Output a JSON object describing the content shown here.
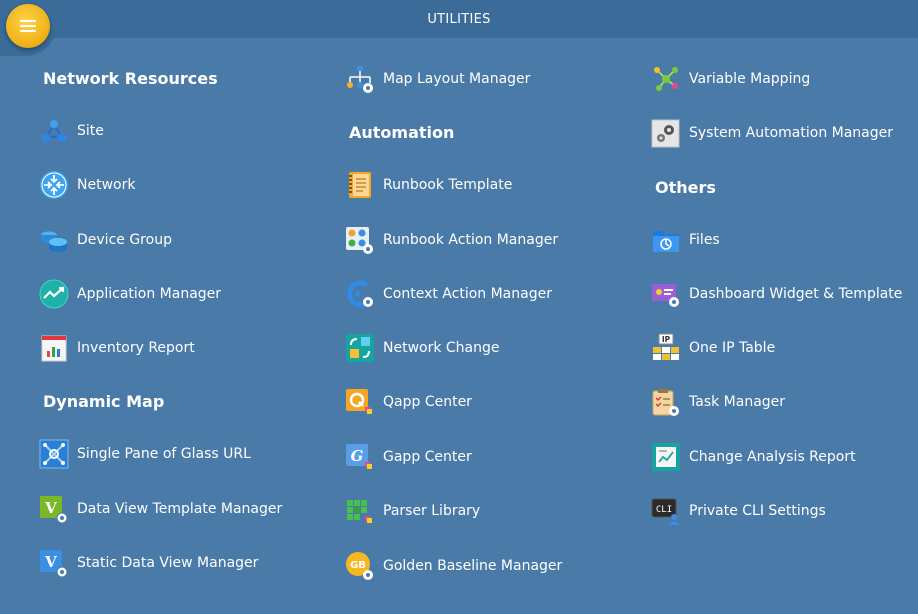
{
  "header": {
    "title": "UTILITIES",
    "menu_icon": "hamburger-icon"
  },
  "columns": [
    {
      "sections": [
        {
          "heading": "Network Resources",
          "items": [
            {
              "label": "Site",
              "icon": "site-icon"
            },
            {
              "label": "Network",
              "icon": "network-icon"
            },
            {
              "label": "Device Group",
              "icon": "device-group-icon"
            },
            {
              "label": "Application Manager",
              "icon": "application-manager-icon"
            },
            {
              "label": "Inventory Report",
              "icon": "inventory-report-icon"
            }
          ]
        },
        {
          "heading": "Dynamic Map",
          "items": [
            {
              "label": "Single Pane of Glass URL",
              "icon": "single-pane-icon"
            },
            {
              "label": "Data View Template Manager",
              "icon": "data-view-template-icon"
            },
            {
              "label": "Static Data View Manager",
              "icon": "static-data-view-icon"
            }
          ]
        }
      ]
    },
    {
      "sections": [
        {
          "heading": "",
          "items": [
            {
              "label": "Map Layout Manager",
              "icon": "map-layout-icon"
            }
          ]
        },
        {
          "heading": "Automation",
          "items": [
            {
              "label": "Runbook Template",
              "icon": "runbook-template-icon"
            },
            {
              "label": "Runbook Action Manager",
              "icon": "runbook-action-icon"
            },
            {
              "label": "Context Action Manager",
              "icon": "context-action-icon"
            },
            {
              "label": "Network Change",
              "icon": "network-change-icon"
            },
            {
              "label": "Qapp Center",
              "icon": "qapp-center-icon"
            },
            {
              "label": "Gapp Center",
              "icon": "gapp-center-icon"
            },
            {
              "label": "Parser Library",
              "icon": "parser-library-icon"
            },
            {
              "label": "Golden Baseline Manager",
              "icon": "golden-baseline-icon"
            }
          ]
        }
      ]
    },
    {
      "sections": [
        {
          "heading": "",
          "items": [
            {
              "label": "Variable Mapping",
              "icon": "variable-mapping-icon"
            },
            {
              "label": "System Automation Manager",
              "icon": "system-automation-icon"
            }
          ]
        },
        {
          "heading": "Others",
          "items": [
            {
              "label": "Files",
              "icon": "files-icon"
            },
            {
              "label": "Dashboard Widget & Template",
              "icon": "dashboard-widget-icon"
            },
            {
              "label": "One IP Table",
              "icon": "one-ip-table-icon"
            },
            {
              "label": "Task Manager",
              "icon": "task-manager-icon"
            },
            {
              "label": "Change Analysis Report",
              "icon": "change-analysis-icon"
            },
            {
              "label": "Private CLI Settings",
              "icon": "private-cli-icon"
            }
          ]
        }
      ]
    }
  ],
  "icon_text": {
    "gb": "GB",
    "ip": "IP",
    "cli": "CLI",
    "v": "V",
    "g": "G"
  },
  "colors": {
    "background": "#4a7ba8",
    "topbar": "#3a6b99",
    "menu_button": "#f2b41c"
  }
}
